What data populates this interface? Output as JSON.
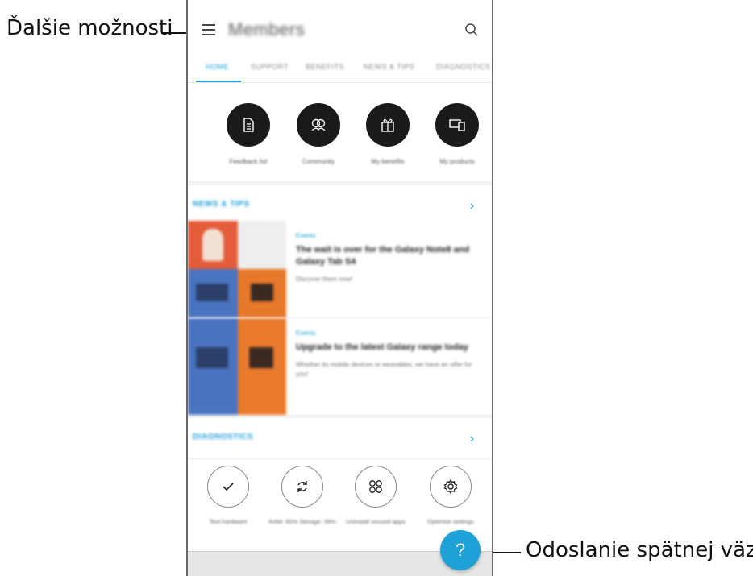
{
  "callouts": {
    "menu_label": "Ďalšie možnosti",
    "fab_label": "Odoslanie spätnej väzby."
  },
  "app": {
    "title": "Members",
    "menu_icon": "hamburger-menu-icon",
    "search_icon": "search-icon"
  },
  "tabs": [
    {
      "label": "HOME",
      "active": true
    },
    {
      "label": "SUPPORT",
      "active": false
    },
    {
      "label": "BENEFITS",
      "active": false
    },
    {
      "label": "NEWS & TIPS",
      "active": false
    },
    {
      "label": "DIAGNOSTICS",
      "active": false
    }
  ],
  "shortcuts": [
    {
      "label": "Feedback list",
      "icon": "document-icon"
    },
    {
      "label": "Community",
      "icon": "community-icon"
    },
    {
      "label": "My benefits",
      "icon": "gift-icon"
    },
    {
      "label": "My products",
      "icon": "devices-icon"
    }
  ],
  "news": {
    "section_title": "NEWS & TIPS",
    "items": [
      {
        "tag": "Events",
        "headline": "The wait is over for the Galaxy Note8 and Galaxy Tab S4",
        "subtitle": "Discover them now!"
      },
      {
        "tag": "Events",
        "headline": "Upgrade to the latest Galaxy range today",
        "subtitle": "Whether its mobile devices or wearables, we have an offer for you!"
      }
    ]
  },
  "diagnostics": {
    "section_title": "DIAGNOSTICS",
    "items": [
      {
        "label": "Test hardware",
        "icon": "check-icon"
      },
      {
        "label": "RAM: 65% Storage: 39%",
        "icon": "refresh-icon"
      },
      {
        "label": "Uninstall unused apps",
        "icon": "apps-grid-icon"
      },
      {
        "label": "Optimise settings",
        "icon": "gear-icon"
      }
    ]
  },
  "fab": {
    "label": "?",
    "icon": "help-icon"
  },
  "colors": {
    "accent": "#1da1d7",
    "circle_dark": "#1a1a1a",
    "background": "#f2f2f2"
  }
}
